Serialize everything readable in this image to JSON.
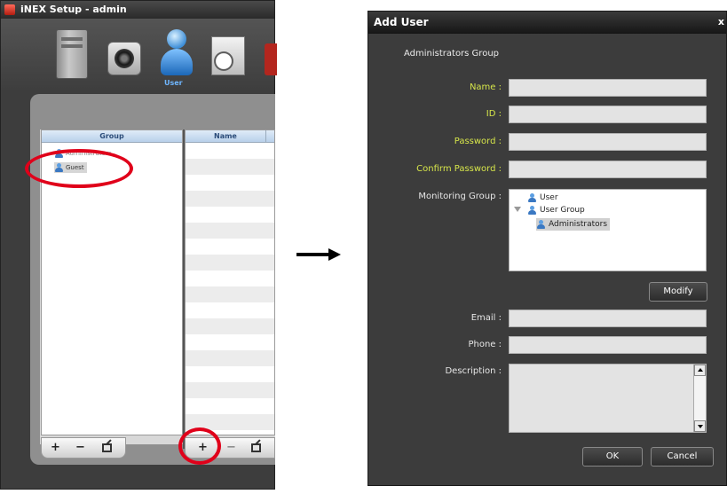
{
  "left_window": {
    "title": "iNEX Setup - admin",
    "toolbar": {
      "icons": [
        "server-icon",
        "camera-icon",
        "user-icon",
        "schedule-icon"
      ],
      "active_label": "User"
    },
    "group_panel": {
      "header": "Group",
      "items": [
        "Administrators",
        "Guest"
      ]
    },
    "name_panel": {
      "header": "Name"
    },
    "buttons": {
      "add": "+",
      "remove": "−"
    }
  },
  "dialog": {
    "title": "Add User",
    "close": "x",
    "group_caption": "Administrators Group",
    "labels": {
      "name": "Name :",
      "id": "ID :",
      "password": "Password :",
      "confirm_password": "Confirm Password :",
      "monitoring_group": "Monitoring Group :",
      "email": "Email :",
      "phone": "Phone :",
      "description": "Description :"
    },
    "monitoring_tree": [
      "User",
      "User Group",
      "Administrators"
    ],
    "buttons": {
      "modify": "Modify",
      "ok": "OK",
      "cancel": "Cancel"
    }
  },
  "colors": {
    "required_label": "#d7e64a",
    "highlight_circle": "#e0001a"
  }
}
